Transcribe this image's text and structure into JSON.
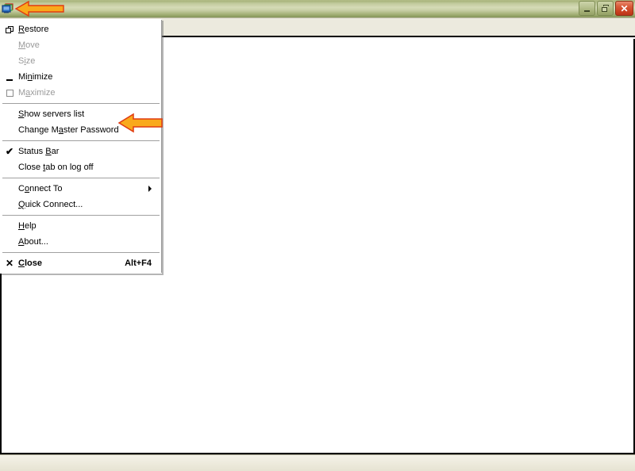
{
  "window": {
    "title": "",
    "icon_name": "remote-desktop-icon",
    "controls": {
      "minimize_label": "Minimize",
      "restore_label": "Restore",
      "close_label": "Close",
      "close_glyph": "✕"
    }
  },
  "toolbar": {
    "tabs": []
  },
  "client": {
    "content": ""
  },
  "statusbar": {
    "text": ""
  },
  "system_menu": {
    "groups": [
      {
        "items": [
          {
            "label": "Restore",
            "accel_index": 0,
            "icon": "restore-icon",
            "enabled": true,
            "bold": false,
            "shortcut": "",
            "submenu": false,
            "checked": false
          },
          {
            "label": "Move",
            "accel_index": 0,
            "icon": "",
            "enabled": false,
            "bold": false,
            "shortcut": "",
            "submenu": false,
            "checked": false
          },
          {
            "label": "Size",
            "accel_index": 1,
            "icon": "",
            "enabled": false,
            "bold": false,
            "shortcut": "",
            "submenu": false,
            "checked": false
          },
          {
            "label": "Minimize",
            "accel_index": 2,
            "icon": "minimize-icon",
            "enabled": true,
            "bold": false,
            "shortcut": "",
            "submenu": false,
            "checked": false
          },
          {
            "label": "Maximize",
            "accel_index": 1,
            "icon": "maximize-icon",
            "enabled": false,
            "bold": false,
            "shortcut": "",
            "submenu": false,
            "checked": false
          }
        ]
      },
      {
        "items": [
          {
            "label": "Show servers list",
            "accel_index": 0,
            "icon": "",
            "enabled": true,
            "bold": false,
            "shortcut": "",
            "submenu": false,
            "checked": false
          },
          {
            "label": "Change Master Password",
            "accel_index": 8,
            "icon": "",
            "enabled": true,
            "bold": false,
            "shortcut": "",
            "submenu": false,
            "checked": false
          }
        ]
      },
      {
        "items": [
          {
            "label": "Status Bar",
            "accel_index": 7,
            "icon": "check-icon",
            "enabled": true,
            "bold": false,
            "shortcut": "",
            "submenu": false,
            "checked": true
          },
          {
            "label": "Close tab on log off",
            "accel_index": 6,
            "icon": "",
            "enabled": true,
            "bold": false,
            "shortcut": "",
            "submenu": false,
            "checked": false
          }
        ]
      },
      {
        "items": [
          {
            "label": "Connect To",
            "accel_index": 1,
            "icon": "",
            "enabled": true,
            "bold": false,
            "shortcut": "",
            "submenu": true,
            "checked": false
          },
          {
            "label": "Quick Connect...",
            "accel_index": 0,
            "icon": "",
            "enabled": true,
            "bold": false,
            "shortcut": "",
            "submenu": false,
            "checked": false
          }
        ]
      },
      {
        "items": [
          {
            "label": "Help",
            "accel_index": 0,
            "icon": "",
            "enabled": true,
            "bold": false,
            "shortcut": "",
            "submenu": false,
            "checked": false
          },
          {
            "label": "About...",
            "accel_index": 0,
            "icon": "",
            "enabled": true,
            "bold": false,
            "shortcut": "",
            "submenu": false,
            "checked": false
          }
        ]
      },
      {
        "items": [
          {
            "label": "Close",
            "accel_index": 0,
            "icon": "close-x-icon",
            "enabled": true,
            "bold": true,
            "shortcut": "Alt+F4",
            "submenu": false,
            "checked": false
          }
        ]
      }
    ]
  },
  "annotations": [
    {
      "name": "arrow-pointing-to-title-bar-icon",
      "direction": "left",
      "target": "window-title-bar"
    },
    {
      "name": "arrow-pointing-to-change-master-password",
      "direction": "left",
      "target": "Change Master Password"
    }
  ],
  "colors": {
    "titlebar_light": "#d5dbb6",
    "titlebar_dark": "#8a9a5e",
    "toolstrip_bg": "#eceade",
    "statusbar_bg": "#edeadc",
    "menu_bg": "#ffffff",
    "menu_disabled_text": "#9a9a9a",
    "arrow_fill": "#f9a91b",
    "arrow_stroke": "#e03a10",
    "close_button": "#c8401f"
  }
}
